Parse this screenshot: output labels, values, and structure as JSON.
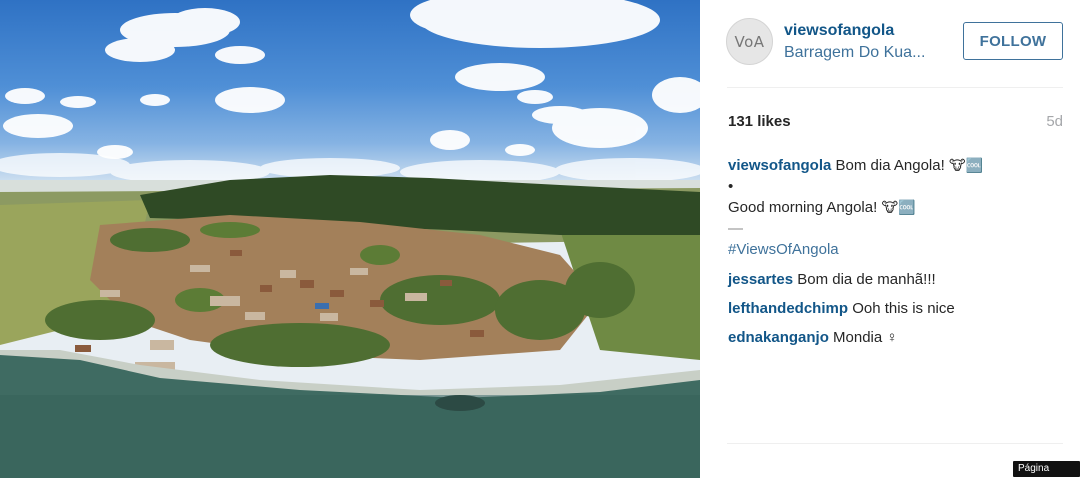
{
  "post": {
    "username": "viewsofangola",
    "avatar_text": "VoA",
    "location": "Barragem Do Kua...",
    "follow_label": "FOLLOW",
    "likes": "131 likes",
    "age": "5d"
  },
  "caption": {
    "user": "viewsofangola",
    "line1_text": "Bom dia Angola!",
    "line1_emoji": "🐮🆒",
    "bullet": "•",
    "line2_text": "Good morning Angola!",
    "line2_emoji": "🐮🆒",
    "dash": "—",
    "hashtag": "#ViewsOfAngola"
  },
  "comments": [
    {
      "user": "jessartes",
      "text": "Bom dia de manhã!!!"
    },
    {
      "user": "lefthandedchimp",
      "text": "Ooh this is nice"
    },
    {
      "user": "ednakanganjo",
      "text": "Mondia ♀"
    }
  ],
  "badge": "Página oficial",
  "colors": {
    "username": "#125688",
    "link": "#3f729b",
    "text": "#262626",
    "muted": "#a5a7aa"
  },
  "icons": {
    "avatar": "avatar-image",
    "photo": "aerial-landscape-photo"
  }
}
